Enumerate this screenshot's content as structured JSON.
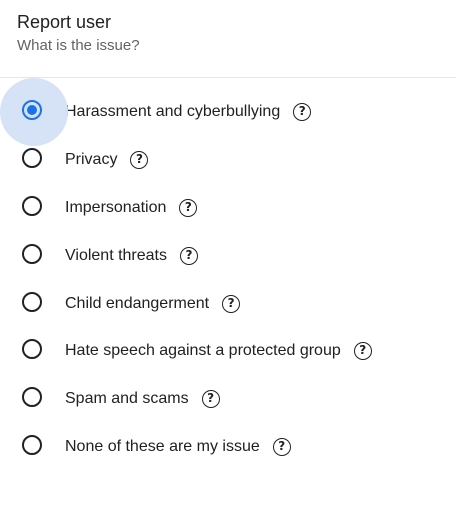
{
  "dialog": {
    "title": "Report user",
    "subtitle": "What is the issue?"
  },
  "colors": {
    "accent": "#1a73e8",
    "halo": "#d6e2f6",
    "text": "#202124",
    "muted": "#5f6368"
  },
  "options": [
    {
      "label": "Harassment and cyberbullying",
      "selected": true,
      "help_icon": "help-circle-icon",
      "help_glyph": "?"
    },
    {
      "label": "Privacy",
      "selected": false,
      "help_icon": "help-circle-icon",
      "help_glyph": "?"
    },
    {
      "label": "Impersonation",
      "selected": false,
      "help_icon": "help-circle-icon",
      "help_glyph": "?"
    },
    {
      "label": "Violent threats",
      "selected": false,
      "help_icon": "help-circle-icon",
      "help_glyph": "?"
    },
    {
      "label": "Child endangerment",
      "selected": false,
      "help_icon": "help-circle-icon",
      "help_glyph": "?"
    },
    {
      "label": "Hate speech against a protected group",
      "selected": false,
      "help_icon": "help-circle-icon",
      "help_glyph": "?"
    },
    {
      "label": "Spam and scams",
      "selected": false,
      "help_icon": "help-circle-icon",
      "help_glyph": "?"
    },
    {
      "label": "None of these are my issue",
      "selected": false,
      "help_icon": "help-circle-icon",
      "help_glyph": "?"
    }
  ]
}
